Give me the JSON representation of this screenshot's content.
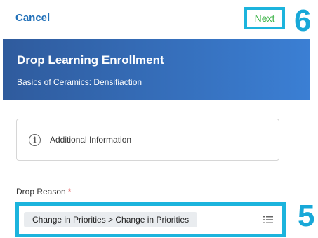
{
  "nav": {
    "cancel_label": "Cancel",
    "next_label": "Next"
  },
  "callouts": {
    "next_step": "6",
    "field_step": "5"
  },
  "header": {
    "title": "Drop Learning Enrollment",
    "subtitle": "Basics of Ceramics: Densifiaction"
  },
  "info": {
    "icon": "info-icon",
    "label": "Additional Information"
  },
  "drop_reason": {
    "label": "Drop Reason",
    "required_marker": "*",
    "selected": "Change in Priorities > Change in Priorities",
    "icon": "list-icon"
  },
  "colors": {
    "header_start": "#2f5b9d",
    "header_end": "#3b7fd4",
    "callout": "#1cb4dd",
    "next": "#3fb44a",
    "cancel": "#1f6fb8"
  }
}
